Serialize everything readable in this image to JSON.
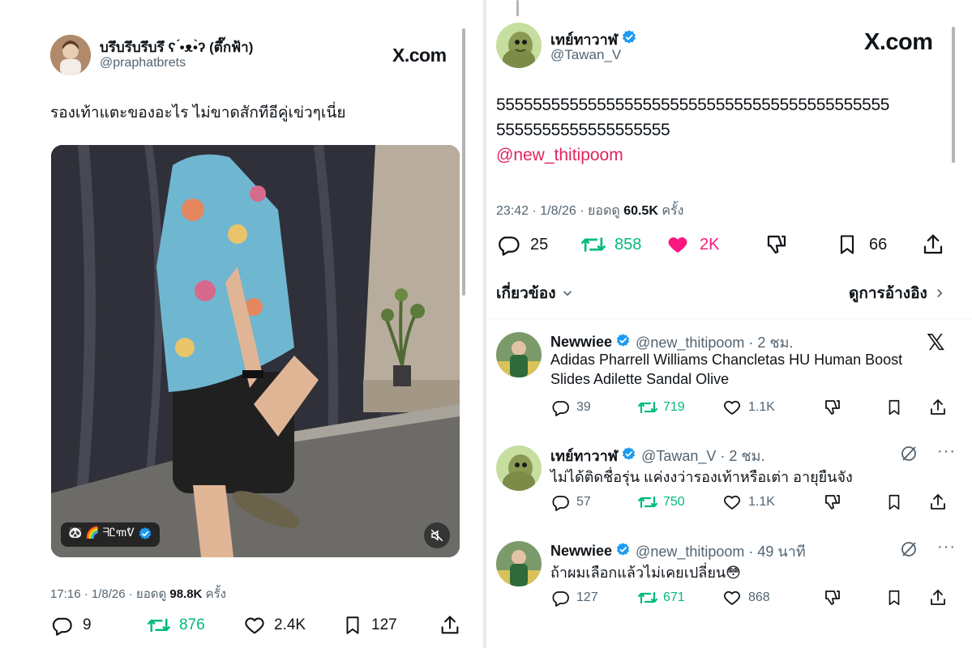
{
  "left_tweet": {
    "display_name": "บรึบรึบรึบรึ ʕ ́•ᴥ•̀ʔ (ตึ๊กฟ้า)",
    "handle": "@praphatbrets",
    "brand": "X.com",
    "text": "รองเท้าแตะของอะไร ไม่ขาดสักทีอีคู่เข่วๆเนี่ย",
    "video_badge_label": "🐼 🌈 ᖷᏝ꧑ᕓ",
    "meta_time": "17:16 · 1/8/26 · ยอดดู",
    "meta_views": "98.8K",
    "meta_views_suffix": "ครั้ง",
    "stats": {
      "replies": "9",
      "retweets": "876",
      "likes": "2.4K",
      "bookmarks": "127"
    }
  },
  "right_tweet": {
    "display_name": "เทย์ทาวาฬ",
    "handle": "@Tawan_V",
    "brand": "X.com",
    "text_line1": "5555555555555555555555555555555555555555555",
    "text_line2": "5555555555555555555",
    "mention": "@new_thitipoom",
    "meta_time": "23:42 · 1/8/26 · ยอดดู",
    "meta_views": "60.5K",
    "meta_views_suffix": "ครั้ง",
    "stats": {
      "replies": "25",
      "retweets": "858",
      "likes": "2K",
      "bookmarks": "66"
    },
    "related_label": "เกี่ยวข้อง",
    "quotes_label": "ดูการอ้างอิง"
  },
  "replies": [
    {
      "name": "Newwiee",
      "handle_time": "@new_thitipoom · 2 ชม.",
      "text_line1": "Adidas Pharrell Williams Chancletas HU Human Boost",
      "text_line2": "Slides Adilette Sandal Olive",
      "stats": {
        "replies": "39",
        "retweets": "719",
        "likes": "1.1K"
      }
    },
    {
      "name": "เทย์ทาวาฬ",
      "handle_time": "@Tawan_V · 2 ชม.",
      "text_line1": "ไม่ได้ติดชื่อรุ่น แค่งงว่ารองเท้าหรือเต่า อายุยืนจัง",
      "text_line2": "",
      "stats": {
        "replies": "57",
        "retweets": "750",
        "likes": "1.1K"
      }
    },
    {
      "name": "Newwiee",
      "handle_time": "@new_thitipoom · 49 นาที",
      "text_line1": "ถ้าผมเลือกแล้วไม่เคยเปลี่ยน😳",
      "text_line2": "",
      "stats": {
        "replies": "127",
        "retweets": "671",
        "likes": "868"
      }
    }
  ],
  "colors": {
    "verified": "#1d9bf0",
    "mention": "#e0245e",
    "retweet": "#00ba7c",
    "like": "#f91880",
    "secondary_text": "#536471"
  }
}
